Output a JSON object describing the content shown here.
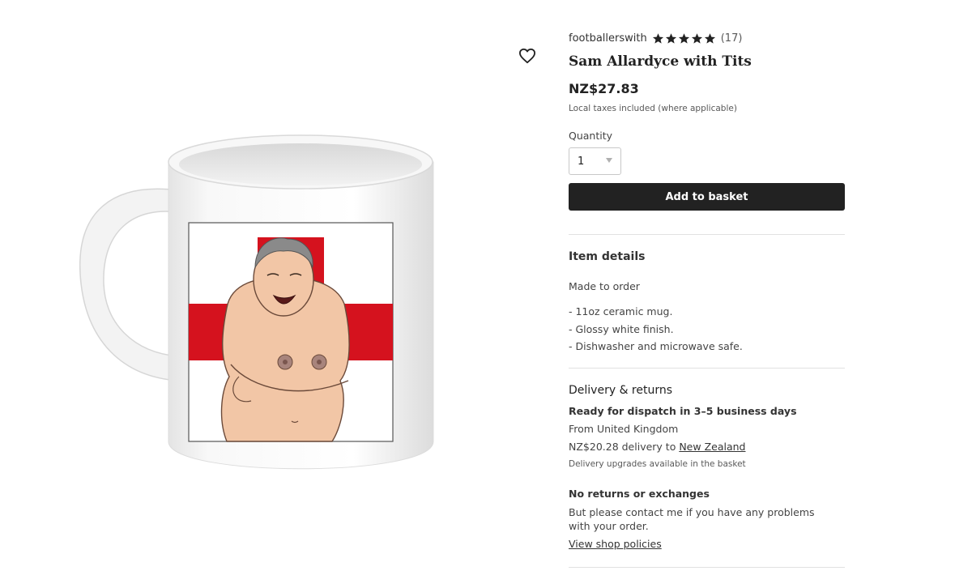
{
  "listing": {
    "shop_name": "footballerswith",
    "rating_stars": 5,
    "review_count": "(17)",
    "title": "Sam Allardyce with Tits",
    "price": "NZ$27.83",
    "tax_note": "Local taxes included (where applicable)"
  },
  "quantity": {
    "label": "Quantity",
    "selected": "1"
  },
  "add_to_basket_label": "Add to basket",
  "item_details": {
    "heading": "Item details",
    "made_to_order": "Made to order",
    "bullets": [
      "- 11oz ceramic mug.",
      "- Glossy white finish.",
      "- Dishwasher and microwave safe."
    ]
  },
  "delivery": {
    "heading": "Delivery & returns",
    "dispatch": "Ready for dispatch in 3–5 business days",
    "from": "From United Kingdom",
    "cost_prefix": "NZ$20.28 delivery to ",
    "destination_link": "New Zealand",
    "upgrades_note": "Delivery upgrades available in the basket",
    "returns_heading": "No returns or exchanges",
    "returns_text": "But please contact me if you have any problems with your order.",
    "policies_link": "View shop policies"
  },
  "colors": {
    "button_bg": "#222222",
    "flag_red": "#d5121e",
    "skin": "#f2c6a6"
  },
  "icons": {
    "favorite": "heart-outline-icon",
    "rating": "star-icon",
    "quantity_caret": "caret-down-icon"
  }
}
